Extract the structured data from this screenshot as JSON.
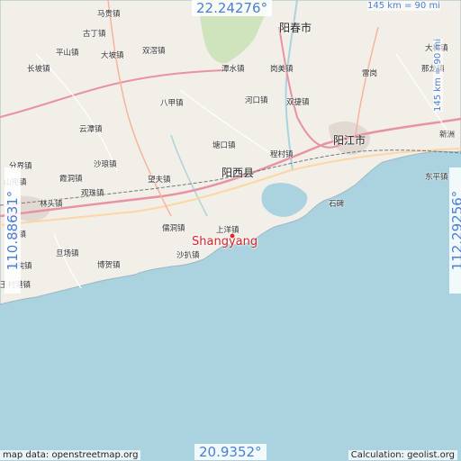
{
  "map": {
    "marker_label": "Shangyang",
    "coords": {
      "lat_top": "22.24276°",
      "lat_bottom": "20.9352°",
      "lon_left": "110.88631°",
      "lon_right": "112.29256°"
    },
    "scale": {
      "horizontal": "145 km = 90 mi",
      "vertical": "145 km = 90 mi"
    },
    "credits": {
      "data": "map data: openstreetmap.org",
      "calculation": "Calculation: geolist.org"
    },
    "places": [
      "马贵镇",
      "古丁镇",
      "平山镇",
      "大坡镇",
      "双滘镇",
      "长坡镇",
      "阳春市",
      "潭水镇",
      "岗美镇",
      "雷岗",
      "大槐镇",
      "那龙镇",
      "八甲镇",
      "河口镇",
      "双捷镇",
      "云潭镇",
      "阳江市",
      "新洲",
      "塘口镇",
      "程村镇",
      "沙琅镇",
      "分界镇",
      "阳西县",
      "霞洞镇",
      "望夫镇",
      "东平镇",
      "山兜镇",
      "观珠镇",
      "林头镇",
      "石碑",
      "儒洞镇",
      "上洋镇",
      "沙扒镇",
      "茂镇",
      "旦场镇",
      "沙院镇",
      "博贺镇",
      "王村港镇"
    ]
  }
}
